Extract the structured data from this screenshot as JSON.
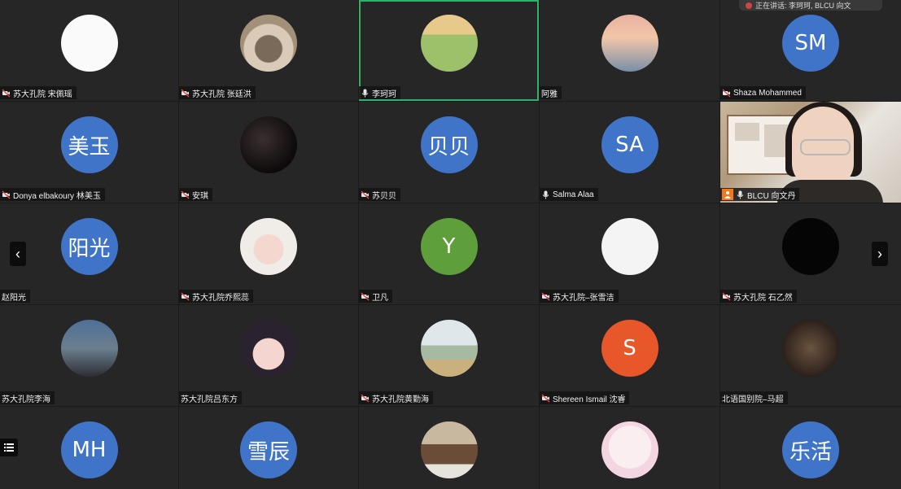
{
  "speaking_indicator": "正在讲话: 李珂珂, BLCU 向文",
  "nav": {
    "prev": "‹",
    "next": "›"
  },
  "tiles": [
    {
      "name": "苏大孔院 宋佩瑶",
      "np_icon": "camera-off",
      "avatar": {
        "kind": "photo",
        "photo": "deer"
      }
    },
    {
      "name": "苏大孔院 张廷洪",
      "np_icon": "camera-off",
      "avatar": {
        "kind": "photo",
        "photo": "food-bowl"
      }
    },
    {
      "name": "李珂珂",
      "np_icon": "mic",
      "speaking": true,
      "avatar": {
        "kind": "photo",
        "photo": "girl-field"
      }
    },
    {
      "name": "阿雅",
      "np_icon": "none",
      "avatar": {
        "kind": "photo",
        "photo": "sunset-window"
      }
    },
    {
      "name": "Shaza Mohammed",
      "np_icon": "camera-off",
      "avatar": {
        "kind": "initials",
        "text": "SM",
        "color": "#3f74c9"
      }
    },
    {
      "name": "Donya elbakoury 林美玉",
      "np_icon": "camera-off",
      "avatar": {
        "kind": "initials",
        "text": "美玉",
        "color": "#3f74c9"
      }
    },
    {
      "name": "安琪",
      "np_icon": "camera-off",
      "avatar": {
        "kind": "photo",
        "photo": "night-stars"
      }
    },
    {
      "name": "苏贝贝",
      "np_icon": "camera-off",
      "avatar": {
        "kind": "initials",
        "text": "贝贝",
        "color": "#3f74c9"
      }
    },
    {
      "name": "Salma Alaa",
      "np_icon": "mic",
      "avatar": {
        "kind": "initials",
        "text": "SA",
        "color": "#3f74c9"
      }
    },
    {
      "name": "BLCU 向文丹",
      "np_icon": "host-mic",
      "avatar": {
        "kind": "video"
      }
    },
    {
      "name": "赵阳光",
      "np_icon": "none",
      "avatar": {
        "kind": "initials",
        "text": "阳光",
        "color": "#3f74c9"
      }
    },
    {
      "name": "苏大孔院乔熙蕊",
      "np_icon": "camera-off",
      "avatar": {
        "kind": "photo",
        "photo": "girl-hood"
      }
    },
    {
      "name": "卫凡",
      "np_icon": "camera-off",
      "avatar": {
        "kind": "initials",
        "text": "Y",
        "color": "#5e9e3b"
      }
    },
    {
      "name": "苏大孔院–张雪洁",
      "np_icon": "camera-off",
      "avatar": {
        "kind": "photo",
        "photo": "bird-sketch"
      }
    },
    {
      "name": "苏大孔院 石乙然",
      "np_icon": "camera-off",
      "avatar": {
        "kind": "photo",
        "photo": "dark"
      }
    },
    {
      "name": "苏大孔院李海",
      "np_icon": "none",
      "avatar": {
        "kind": "photo",
        "photo": "group"
      }
    },
    {
      "name": "苏大孔院吕东方",
      "np_icon": "none",
      "avatar": {
        "kind": "photo",
        "photo": "anime"
      }
    },
    {
      "name": "苏大孔院黄勤海",
      "np_icon": "camera-off",
      "avatar": {
        "kind": "photo",
        "photo": "boats"
      }
    },
    {
      "name": "Shereen Ismail 沈睿",
      "np_icon": "camera-off",
      "avatar": {
        "kind": "initials",
        "text": "S",
        "color": "#e8572a"
      }
    },
    {
      "name": "北语国别院–马超",
      "np_icon": "none",
      "avatar": {
        "kind": "photo",
        "photo": "crowd"
      }
    },
    {
      "name": "",
      "np_icon": "none",
      "avatar": {
        "kind": "initials",
        "text": "MH",
        "color": "#3f74c9"
      }
    },
    {
      "name": "",
      "np_icon": "none",
      "avatar": {
        "kind": "initials",
        "text": "雪辰",
        "color": "#3f74c9"
      }
    },
    {
      "name": "",
      "np_icon": "none",
      "avatar": {
        "kind": "photo",
        "photo": "building"
      }
    },
    {
      "name": "",
      "np_icon": "none",
      "avatar": {
        "kind": "photo",
        "photo": "cartoon-girl"
      }
    },
    {
      "name": "",
      "np_icon": "none",
      "avatar": {
        "kind": "initials",
        "text": "乐活",
        "color": "#3f74c9"
      }
    }
  ]
}
